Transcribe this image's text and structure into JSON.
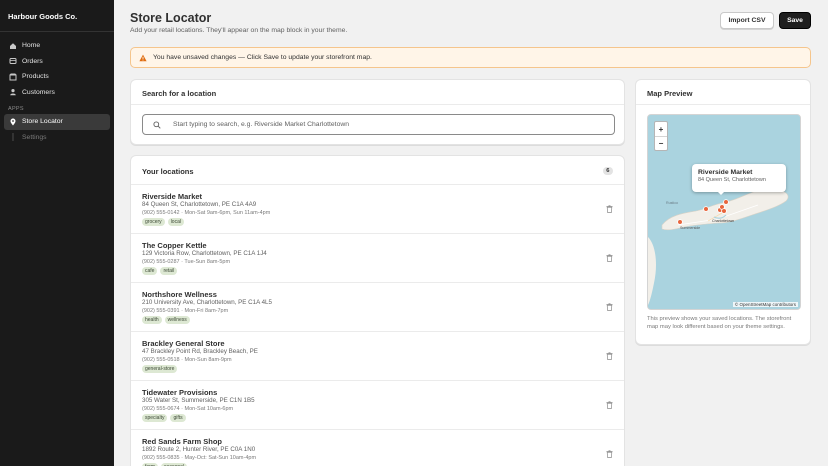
{
  "sidebar": {
    "brand": "Harbour Goods Co.",
    "items": [
      {
        "label": "Home",
        "icon": "home-icon"
      },
      {
        "label": "Orders",
        "icon": "orders-icon"
      },
      {
        "label": "Products",
        "icon": "products-icon"
      },
      {
        "label": "Customers",
        "icon": "customers-icon"
      }
    ],
    "apps_section": "APPS",
    "apps": [
      {
        "label": "Store Locator",
        "icon": "map-pin-icon",
        "active": true
      },
      {
        "label": "Settings",
        "sub": true
      }
    ]
  },
  "header": {
    "title": "Store Locator",
    "subtitle": "Add your retail locations. They'll appear on the map block in your theme.",
    "import_label": "Import CSV",
    "save_label": "Save"
  },
  "banner": {
    "text": "You have unsaved changes — Click Save to update your storefront map."
  },
  "search": {
    "title": "Search for a location",
    "placeholder": "Start typing to search, e.g. Riverside Market Charlottetown",
    "value": ""
  },
  "locations": {
    "title": "Your locations",
    "count": "6",
    "items": [
      {
        "name": "Riverside Market",
        "address": "84 Queen St, Charlottetown, PE C1A 4A9",
        "meta": "(902) 555-0142 · Mon-Sat 9am-6pm, Sun 11am-4pm",
        "tags": [
          "grocery",
          "local"
        ]
      },
      {
        "name": "The Copper Kettle",
        "address": "129 Victoria Row, Charlottetown, PE C1A 1J4",
        "meta": "(902) 555-0287 · Tue-Sun 8am-5pm",
        "tags": [
          "cafe",
          "retail"
        ]
      },
      {
        "name": "Northshore Wellness",
        "address": "210 University Ave, Charlottetown, PE C1A 4L5",
        "meta": "(902) 555-0391 · Mon-Fri 8am-7pm",
        "tags": [
          "health",
          "wellness"
        ]
      },
      {
        "name": "Brackley General Store",
        "address": "47 Brackley Point Rd, Brackley Beach, PE",
        "meta": "(902) 555-0518 · Mon-Sun 8am-9pm",
        "tags": [
          "general-store"
        ]
      },
      {
        "name": "Tidewater Provisions",
        "address": "305 Water St, Summerside, PE C1N 1B5",
        "meta": "(902) 555-0674 · Mon-Sat 10am-6pm",
        "tags": [
          "specialty",
          "gifts"
        ]
      },
      {
        "name": "Red Sands Farm Shop",
        "address": "1892 Route 2, Hunter River, PE C0A 1N0",
        "meta": "(902) 555-0835 · May-Oct: Sat-Sun 10am-4pm",
        "tags": [
          "farm",
          "seasonal"
        ]
      }
    ]
  },
  "map": {
    "title": "Map Preview",
    "zoom_in": "+",
    "zoom_out": "−",
    "popup_name": "Riverside Market",
    "popup_address": "84 Queen St, Charlottetown",
    "place_label_1": "Charlottetown",
    "place_label_2": "Summerside",
    "place_label_3": "Rustico",
    "attribution": "© OpenStreetMap contributors",
    "note": "This preview shows your saved locations. The storefront map may look different based on your theme settings.",
    "water_color": "#aad3df",
    "land_color": "#f2efe9",
    "marker_color": "#e8663d"
  },
  "colors": {
    "sidebar_bg": "#1a1a1a",
    "primary_button": "#1f1f1f",
    "banner_bg": "#fff5e8",
    "banner_border": "#f5c58c",
    "warning_icon": "#e06d10",
    "tag_bg": "#dde8d3"
  }
}
